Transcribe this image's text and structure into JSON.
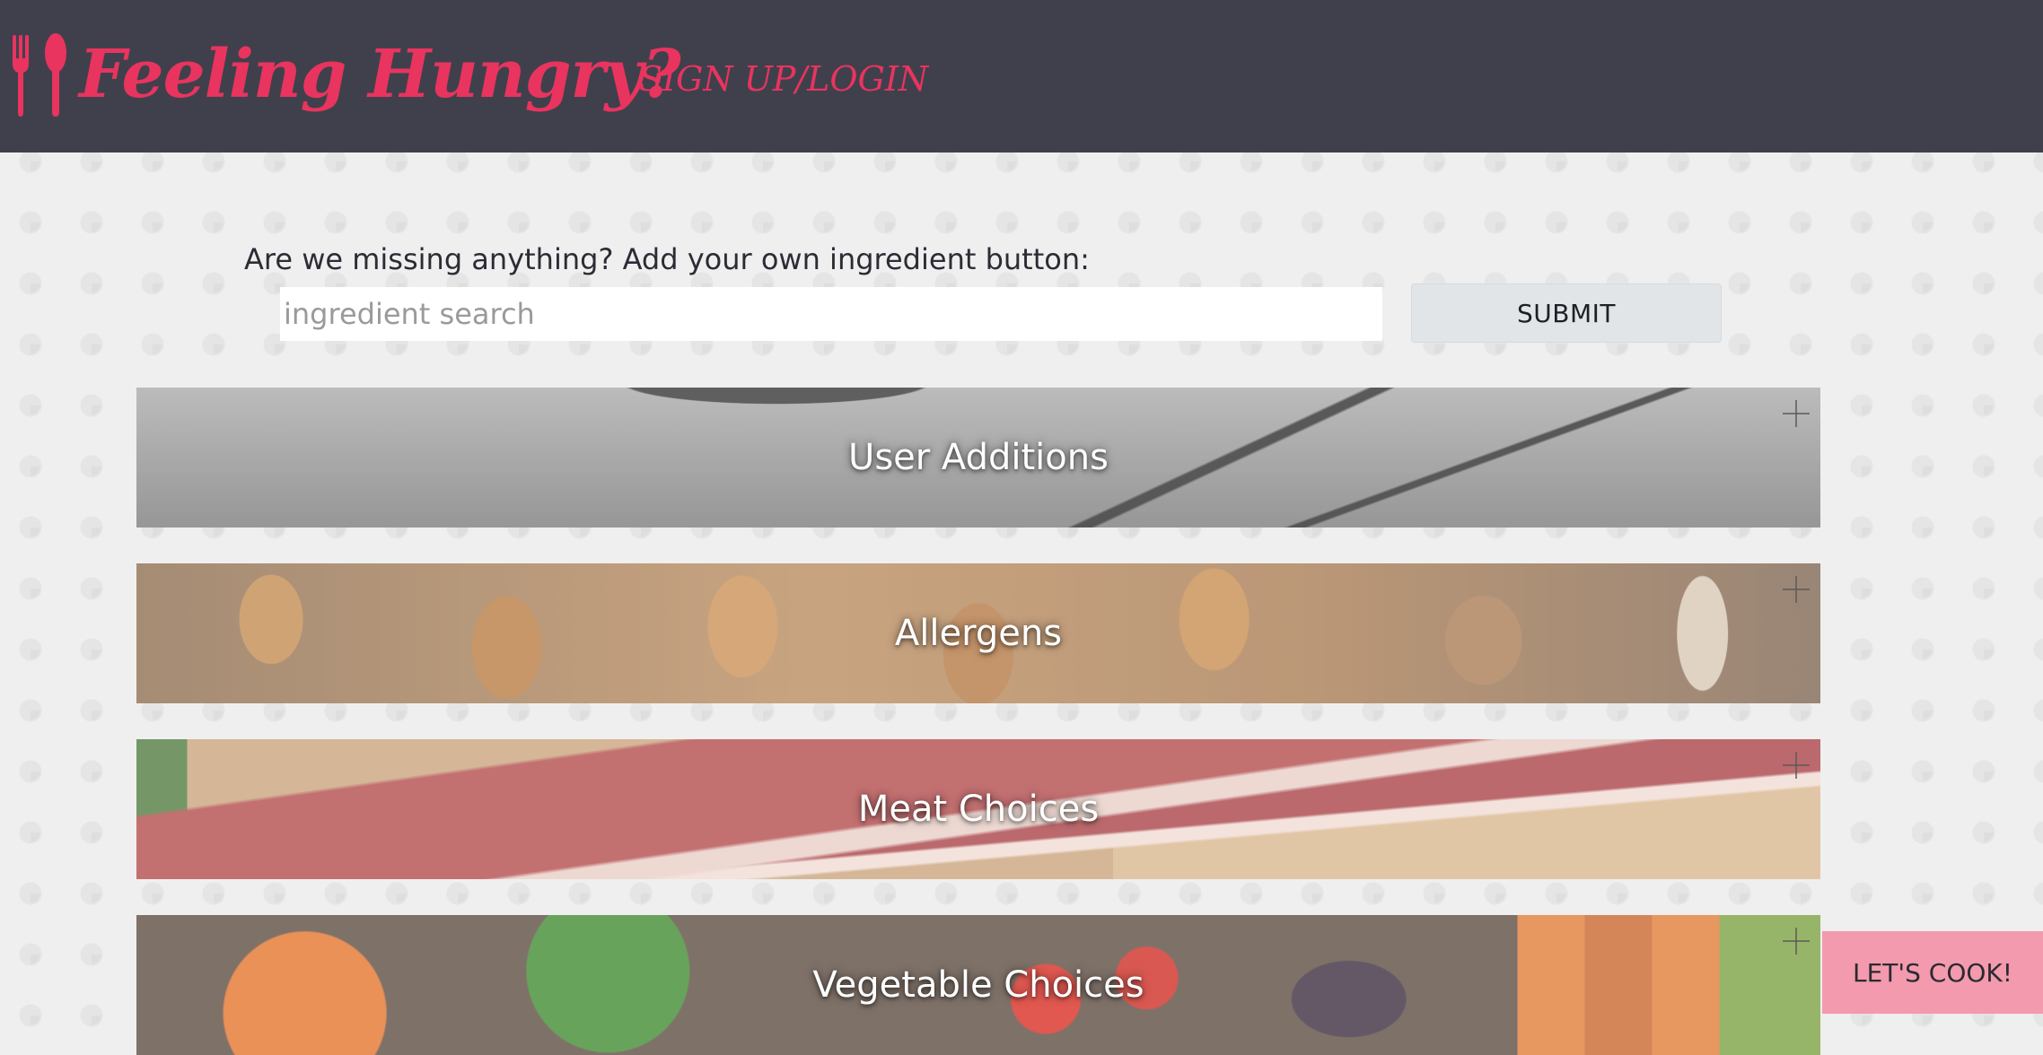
{
  "header": {
    "brand_title": "Feeling Hungry?",
    "brand_icon": "fork-spoon-icon",
    "nav_signup_login": "SIGN UP/LOGIN"
  },
  "ingredient_form": {
    "prompt": "Are we missing anything? Add your own ingredient button:",
    "search_placeholder": "ingredient search",
    "search_value": "",
    "submit_label": "SUBMIT"
  },
  "categories": [
    {
      "label": "User Additions",
      "icon": "plus-icon"
    },
    {
      "label": "Allergens",
      "icon": "plus-icon"
    },
    {
      "label": "Meat Choices",
      "icon": "plus-icon"
    },
    {
      "label": "Vegetable Choices",
      "icon": "plus-icon"
    }
  ],
  "actions": {
    "lets_cook_label": "LET'S COOK!"
  },
  "colors": {
    "navbar_bg": "#40404c",
    "brand_accent": "#e8345f",
    "lets_cook_bg": "#f39aae",
    "submit_bg": "#e1e5e8"
  }
}
